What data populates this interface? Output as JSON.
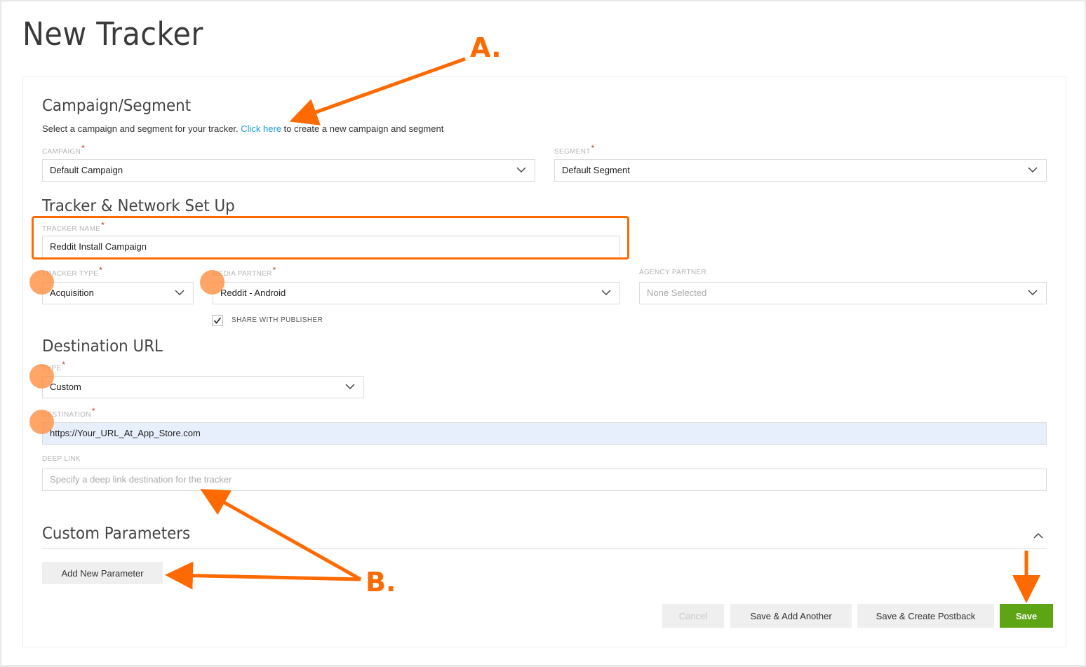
{
  "page": {
    "title": "New Tracker"
  },
  "campaign_segment": {
    "title": "Campaign/Segment",
    "subtitle_before": "Select a campaign and segment for your tracker. ",
    "subtitle_link": "Click here",
    "subtitle_after": " to create a new campaign and segment",
    "campaign": {
      "label": "CAMPAIGN",
      "required": "*",
      "value": "Default Campaign"
    },
    "segment": {
      "label": "SEGMENT",
      "required": "*",
      "value": "Default Segment"
    }
  },
  "tracker_setup": {
    "title": "Tracker & Network Set Up",
    "tracker_name": {
      "label": "TRACKER NAME",
      "required": "*",
      "value": "Reddit Install Campaign"
    },
    "tracker_type": {
      "label": "TRACKER TYPE",
      "required": "*",
      "value": "Acquisition"
    },
    "media_partner": {
      "label": "MEDIA PARTNER",
      "required": "*",
      "value": "Reddit - Android"
    },
    "agency_partner": {
      "label": "AGENCY PARTNER",
      "value": "None Selected"
    },
    "share_with_publisher": {
      "label": "SHARE WITH PUBLISHER",
      "checked": true
    }
  },
  "destination_url": {
    "title": "Destination URL",
    "type": {
      "label": "TYPE",
      "required": "*",
      "value": "Custom"
    },
    "destination": {
      "label": "DESTINATION",
      "required": "*",
      "value": "https://Your_URL_At_App_Store.com"
    },
    "deep_link": {
      "label": "DEEP LINK",
      "placeholder": "Specify a deep link destination for the tracker",
      "value": ""
    }
  },
  "custom_parameters": {
    "title": "Custom Parameters",
    "add_button": "Add New Parameter",
    "collapse_icon": "chevron-up-icon"
  },
  "actions": {
    "cancel": "Cancel",
    "save_add_another": "Save & Add Another",
    "save_create_postback": "Save & Create Postback",
    "save": "Save"
  },
  "annotations": {
    "a_label": "A.",
    "b_label": "B.",
    "color": "#ff6a00"
  },
  "colors": {
    "accent_link": "#1a9bd7",
    "save_button": "#5ea515",
    "destination_bg": "#e8effc",
    "annotation": "#ff6a00"
  }
}
